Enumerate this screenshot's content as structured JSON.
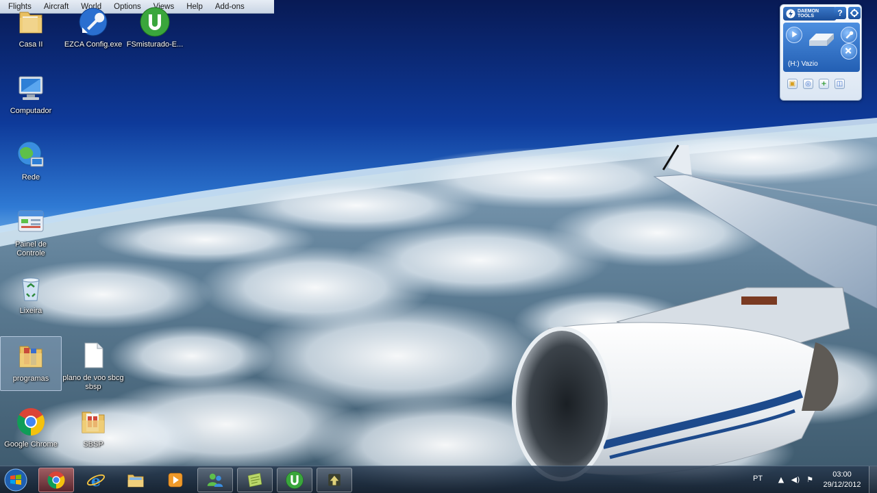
{
  "menubar": {
    "items": [
      "Flights",
      "Aircraft",
      "World",
      "Options",
      "Views",
      "Help",
      "Add-ons"
    ]
  },
  "desktop": {
    "icons": [
      {
        "label": "Casa II",
        "icon": "folder-icon"
      },
      {
        "label": "EZCA Config.exe",
        "icon": "wrench-icon"
      },
      {
        "label": "FSmisturado-E...",
        "icon": "utorrent-icon"
      },
      {
        "label": "Computador",
        "icon": "computer-icon"
      },
      {
        "label": "Rede",
        "icon": "network-icon"
      },
      {
        "label": "Painel de Controle",
        "icon": "control-panel-icon"
      },
      {
        "label": "Lixeira",
        "icon": "recycle-bin-icon"
      },
      {
        "label": "programas",
        "icon": "folder-icon"
      },
      {
        "label": "plano de voo sbcg sbsp",
        "icon": "document-icon"
      },
      {
        "label": "Google Chrome",
        "icon": "chrome-icon"
      },
      {
        "label": "SBSP",
        "icon": "folder-icon"
      }
    ]
  },
  "daemon": {
    "brand_line1": "DAEMON",
    "brand_line2": "TOOLS",
    "help": "?",
    "drive_label": "(H:) Vazio"
  },
  "taskbar": {
    "language": "PT",
    "time": "03:00",
    "date": "29/12/2012",
    "pinned": [
      "chrome-icon",
      "internet-explorer-icon",
      "explorer-folder-icon",
      "media-player-icon",
      "network-users-icon",
      "notes-icon",
      "utorrent-icon",
      "flight-sim-icon"
    ]
  },
  "colors": {
    "sky_top": "#0b1f5c",
    "sky_horizon": "#5fa8e6",
    "accent_daemon": "#235fb3",
    "utorrent_green": "#3aa63c"
  }
}
